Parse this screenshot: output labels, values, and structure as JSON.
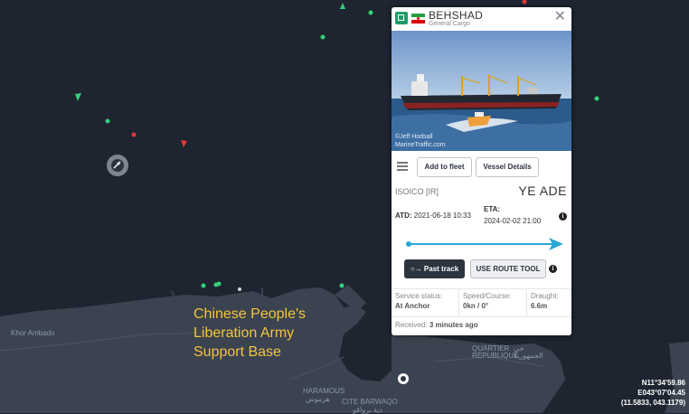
{
  "map": {
    "overlay_label_lines": [
      "Chinese People's",
      "Liberation Army",
      "Support Base"
    ],
    "place_labels": {
      "khor_ambado": "Khor Ambado",
      "haramous": "HARAMOUS",
      "cite_barwaqo": "CITE BARWAQO",
      "quartier_republique": "QUARTIER\nRÉPUBLIQUE",
      "arabic_1": "هرموس",
      "arabic_2": "دية برواقو",
      "arabic_3": "حي\nالجمهورية"
    },
    "coordinates": {
      "lat": "N11°34'59.86",
      "lon": "E043°07'04.45",
      "decimal": "(11.5833, 043.1179)"
    },
    "colors": {
      "sea": "#1e2530",
      "land": "#3b4350",
      "cargo_green": "#33d17a",
      "tanker_red": "#e03a3a"
    }
  },
  "vessel": {
    "name": "BEHSHAD",
    "type": "General Cargo",
    "flag": "Iran",
    "photo_credit_lines": [
      "©Jeff Hodsall",
      "MarineTraffic.com"
    ],
    "menu_icon": "hamburger-icon",
    "add_to_fleet_label": "Add to fleet",
    "vessel_details_label": "Vessel Details",
    "owner": "ISOICO [IR]",
    "route_from": "YE",
    "route_to": "ADE",
    "atd_label": "ATD:",
    "atd_value": "2021-06-18 10:33",
    "eta_label": "ETA:",
    "eta_value": "2024-02-02 21:00",
    "past_track_label": "Past track",
    "route_tool_label": "USE ROUTE TOOL",
    "service_status_label": "Service status:",
    "service_status_value": "At Anchor",
    "speed_course_label": "Speed/Course:",
    "speed_course_value": "0kn / 0°",
    "draught_label": "Draught:",
    "draught_value": "6.6m",
    "received_label": "Received:",
    "received_value": "3 minutes ago",
    "accent_color": "#2aa6d6"
  }
}
